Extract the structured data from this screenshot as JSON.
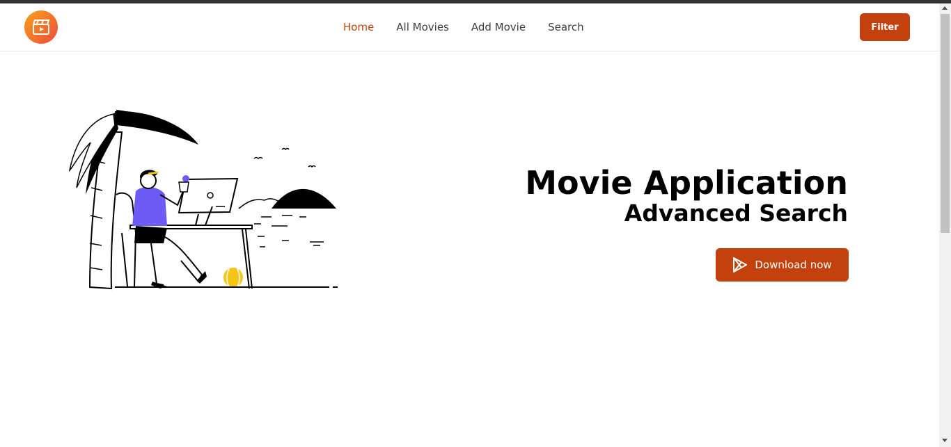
{
  "nav": {
    "logo_icon": "movie-clapper-icon",
    "links": [
      {
        "label": "Home",
        "active": true
      },
      {
        "label": "All Movies",
        "active": false
      },
      {
        "label": "Add Movie",
        "active": false
      },
      {
        "label": "Search",
        "active": false
      }
    ],
    "filter_label": "Filter"
  },
  "hero": {
    "title": "Movie Application",
    "subtitle": "Advanced Search",
    "download_label": "Download now",
    "download_icon": "google-play-icon",
    "illustration": "person-working-on-laptop-under-palm-tree"
  },
  "colors": {
    "accent": "#c2410c",
    "logo_gradient_start": "#f7a21a",
    "logo_gradient_end": "#ef4b3c",
    "person_shirt": "#6c5cf5",
    "ball": "#f5c518"
  }
}
